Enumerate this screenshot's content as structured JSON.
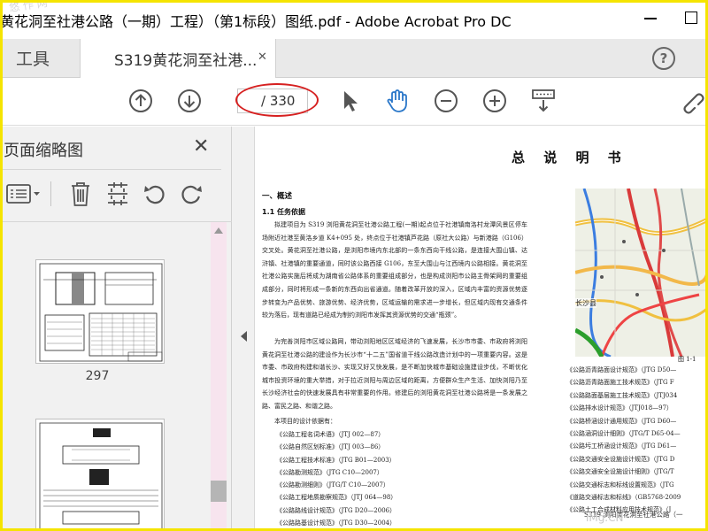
{
  "window": {
    "title": "黄花洞至社港公路（一期）工程）（第1标段）图纸.pdf - Adobe Acrobat Pro DC"
  },
  "tabs": {
    "tools_label": "工具",
    "document_label": "S319黄花洞至社港...",
    "close_glyph": "✕",
    "help_glyph": "?"
  },
  "toolbar": {
    "current_page": "",
    "total_pages": "/ 330",
    "icons": [
      "prev-page",
      "next-page",
      "select-arrow",
      "hand-tool",
      "zoom-out",
      "zoom-in",
      "scroll-mode",
      "link"
    ]
  },
  "thumbnail_panel": {
    "title": "页面缩略图",
    "close_glyph": "✕",
    "thumbnails": [
      {
        "page_number": "297"
      },
      {
        "page_number": ""
      }
    ],
    "icons": [
      "options-list",
      "delete",
      "crop",
      "rotate-left",
      "rotate-right"
    ]
  },
  "document": {
    "heading": "总 说 明 书",
    "section": "一、概述",
    "subsection": "1.1 任务依据",
    "paragraph1": "拟建项目为 S319 浏阳黄花洞至社港公路工程(一期)起点位于社港镇南洛村龙潭风景区停车场附近社港至黄洛乡道 K4+095 处，终点位于社港镇芦花路（原社大公路）与新港路（G106）交叉处。黄花洞至社港公路，是浏阳市境内东北部的一条东西向干线公路，是连接大围山镇、达浒镇、社港镇的重要通道，同时该公路西接 G106，东至大围山与江西境内公路相接。黄花洞至社港公路实施后将成为湖南省公路体系的重要组成部分，也是构成浏阳市公路主骨架网的重要组成部分，同时将形成一条新的东西向出省通道。随着改革开放的深入，区域内丰富的资源优势逐步转变为产品优势、旅游优势、经济优势，区域运输的需求进一步增长，但区域内现有交通条件较为落后，现有道路已经成为制约浏阳市发挥其资源优势的交通“瓶颈”。",
    "paragraph2": "为完善浏阳市区域公路网，带动浏阳地区区域经济的飞速发展，长沙市市委、市政府将浏阳黄花洞至社港公路的建设作为长沙市“十二五”国省道干线公路改造计划中的一项重要内容。这是市委、市政府构建和谐长沙、实现又好又快发展，是不断加快城市基础设施建设步伐，不断优化城市投资环境的重大举措，对于拉近浏阳与周边区域的距离，方便群众生产生活、加快浏阳乃至长沙经济社会的快速发展具有非常重要的作用。修建后的浏阳黄花洞至社港公路将是一条发展之路、富民之路、和谐之路。",
    "paragraph3": "本项目的设计依据有：",
    "references_left": [
      "《公路工程名词术语》（JTJ 002—87）",
      "《公路自然区划标准》（JTJ 003—86）",
      "《公路工程技术标准》（JTG B01—2003）",
      "《公路勘测规范》（JTG C10—2007）",
      "《公路勘测细则》（JTG/T C10—2007）",
      "《公路工程地质勘察规范》（JTJ 064—98）",
      "《公路路线设计规范》（JTG D20—2006）",
      "《公路路基设计规范》（JTG D30—2004）"
    ],
    "references_right": [
      "《公路沥青路面设计规范》（JTG D50—",
      "《公路沥青路面施工技术规范》（JTG F",
      "《公路路面基层施工技术规范》（JTJ034",
      "《公路排水设计规范》（JTJ018—97）",
      "《公路桥涵设计通用规范》（JTG D60—",
      "《公路涵洞设计细则》（JTG/T D65-04—",
      "《公路圬工桥涵设计规范》（JTG D61—",
      "《公路交通安全设施设计规范》（JTG D",
      "《公路交通安全设施设计细则》（JTG/T",
      "《公路交通标志和标线设置规范》（JTG",
      "《道路交通标志和标线》（GB5768-2009",
      "《公路土工合成材料应用技术规范》（J"
    ],
    "figure_label": "图 1-1",
    "map_place_label": "长沙县",
    "footer_label": "S319 浏阳黄花洞至社港公路（一"
  },
  "overlays": {
    "watermark_top_left": "悠 作 网",
    "watermark_bottom_right": "iMg.CN"
  },
  "colors": {
    "highlight_ellipse": "#d62020",
    "frame": "#f5e400",
    "hand_tool_accent": "#2a77c9"
  }
}
